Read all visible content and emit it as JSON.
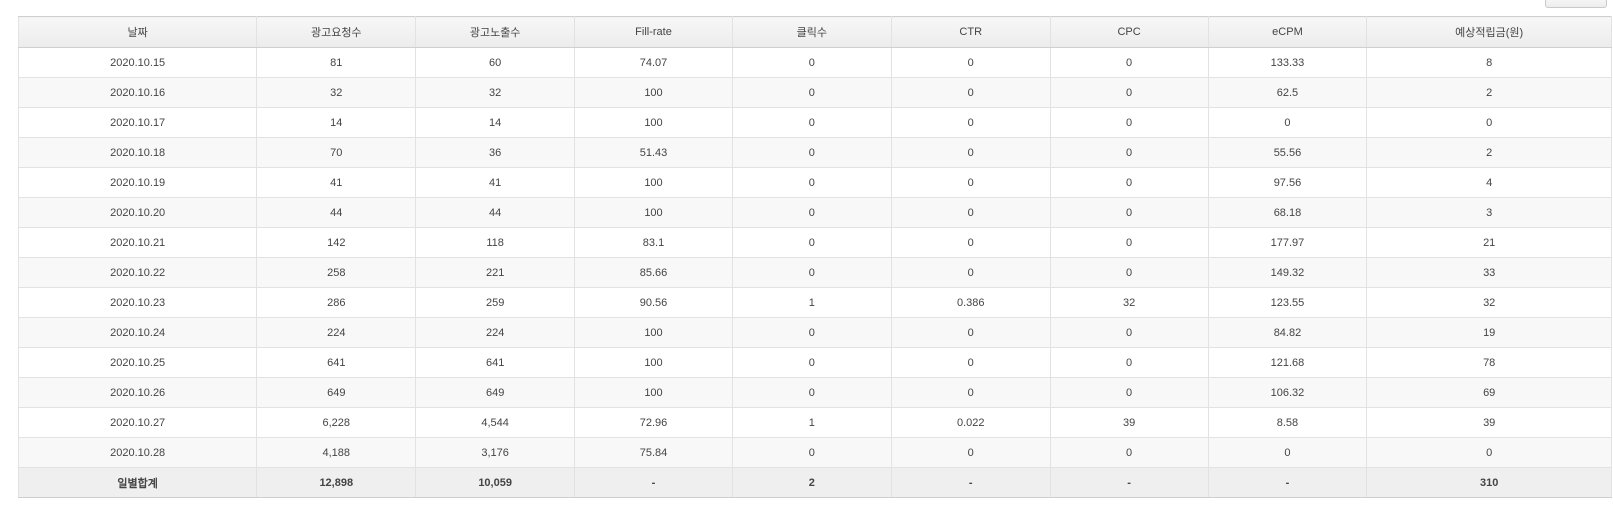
{
  "table": {
    "columns": [
      "날짜",
      "광고요청수",
      "광고노출수",
      "Fill-rate",
      "클릭수",
      "CTR",
      "CPC",
      "eCPM",
      "예상적립금(원)"
    ],
    "rows": [
      [
        "2020.10.15",
        "81",
        "60",
        "74.07",
        "0",
        "0",
        "0",
        "133.33",
        "8"
      ],
      [
        "2020.10.16",
        "32",
        "32",
        "100",
        "0",
        "0",
        "0",
        "62.5",
        "2"
      ],
      [
        "2020.10.17",
        "14",
        "14",
        "100",
        "0",
        "0",
        "0",
        "0",
        "0"
      ],
      [
        "2020.10.18",
        "70",
        "36",
        "51.43",
        "0",
        "0",
        "0",
        "55.56",
        "2"
      ],
      [
        "2020.10.19",
        "41",
        "41",
        "100",
        "0",
        "0",
        "0",
        "97.56",
        "4"
      ],
      [
        "2020.10.20",
        "44",
        "44",
        "100",
        "0",
        "0",
        "0",
        "68.18",
        "3"
      ],
      [
        "2020.10.21",
        "142",
        "118",
        "83.1",
        "0",
        "0",
        "0",
        "177.97",
        "21"
      ],
      [
        "2020.10.22",
        "258",
        "221",
        "85.66",
        "0",
        "0",
        "0",
        "149.32",
        "33"
      ],
      [
        "2020.10.23",
        "286",
        "259",
        "90.56",
        "1",
        "0.386",
        "32",
        "123.55",
        "32"
      ],
      [
        "2020.10.24",
        "224",
        "224",
        "100",
        "0",
        "0",
        "0",
        "84.82",
        "19"
      ],
      [
        "2020.10.25",
        "641",
        "641",
        "100",
        "0",
        "0",
        "0",
        "121.68",
        "78"
      ],
      [
        "2020.10.26",
        "649",
        "649",
        "100",
        "0",
        "0",
        "0",
        "106.32",
        "69"
      ],
      [
        "2020.10.27",
        "6,228",
        "4,544",
        "72.96",
        "1",
        "0.022",
        "39",
        "8.58",
        "39"
      ],
      [
        "2020.10.28",
        "4,188",
        "3,176",
        "75.84",
        "0",
        "0",
        "0",
        "0",
        "0"
      ]
    ],
    "total": [
      "일별합계",
      "12,898",
      "10,059",
      "-",
      "2",
      "-",
      "-",
      "-",
      "310"
    ]
  }
}
